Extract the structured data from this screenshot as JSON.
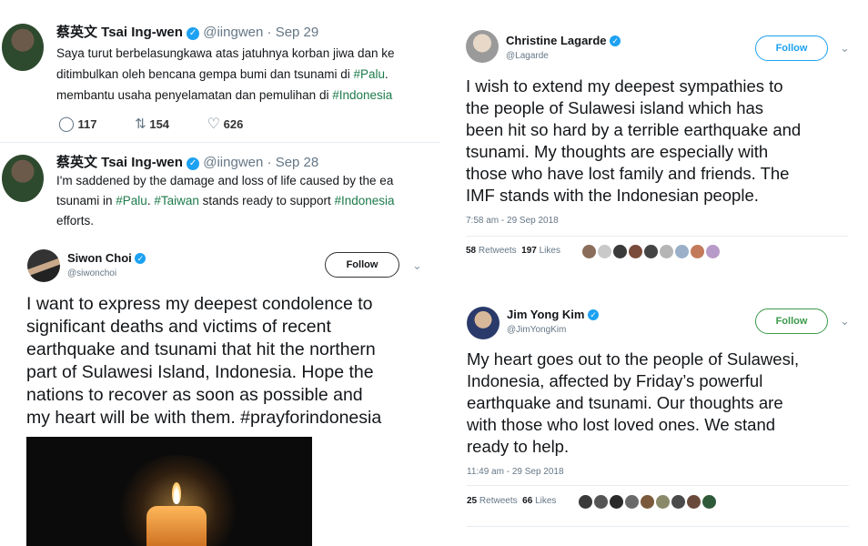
{
  "tweet1": {
    "name": "蔡英文 Tsai Ing-wen",
    "handle": "@iingwen",
    "sep": "·",
    "date": "Sep 29",
    "line1": "Saya turut berbelasungkawa atas jatuhnya korban jiwa dan ke",
    "line2a": "ditimbulkan oleh bencana gempa bumi dan tsunami di ",
    "line2b": "#Palu",
    "line2c": ".",
    "line3a": "membantu usaha penyelamatan dan pemulihan di ",
    "line3b": "#Indonesia",
    "replies": "117",
    "retweets": "154",
    "likes": "626"
  },
  "tweet2": {
    "name": "蔡英文 Tsai Ing-wen",
    "handle": "@iingwen",
    "sep": "·",
    "date": "Sep 28",
    "line1": "I'm saddened by the damage and loss of life caused by the ea",
    "line2a": "tsunami in ",
    "line2b": "#Palu",
    "line2c": ". ",
    "line2d": "#Taiwan",
    "line2e": " stands ready to support ",
    "line2f": "#Indonesia",
    "line3": "efforts."
  },
  "tweet3": {
    "name": "Siwon Choi",
    "handle": "@siwonchoi",
    "follow_label": "Follow",
    "lines": [
      "I want to express my deepest condolence to",
      "significant deaths and victims of recent",
      "earthquake and tsunami that hit the northern",
      "part of Sulawesi Island, Indonesia. Hope the",
      "nations to recover as soon as possible and",
      "my heart will be with them. #prayforindonesia"
    ]
  },
  "tweet4": {
    "name": "Christine Lagarde",
    "handle": "@Lagarde",
    "follow_label": "Follow",
    "lines": [
      "I wish to extend my deepest sympathies to",
      "the people of Sulawesi island which has",
      "been hit so hard by a terrible earthquake and",
      "tsunami. My thoughts are especially with",
      "those who have lost family and friends. The",
      "IMF stands with the Indonesian people."
    ],
    "timestamp": "7:58 am - 29 Sep 2018",
    "retweets_count": "58",
    "retweets_label": "Retweets",
    "likes_count": "197",
    "likes_label": "Likes"
  },
  "tweet5": {
    "name": "Jim Yong Kim",
    "handle": "@JimYongKim",
    "follow_label": "Follow",
    "lines": [
      "My heart goes out to the people of Sulawesi,",
      "Indonesia, affected by Friday’s powerful",
      "earthquake and tsunami. Our thoughts are",
      "with those who lost loved ones. We stand",
      "ready to help."
    ],
    "timestamp": "11:49 am - 29 Sep 2018",
    "retweets_count": "25",
    "retweets_label": "Retweets",
    "likes_count": "66",
    "likes_label": "Likes"
  },
  "colors": {
    "verified": "#1da1f2",
    "hashtag": "#1c7a4a",
    "follow_green": "#3a9a4a"
  }
}
